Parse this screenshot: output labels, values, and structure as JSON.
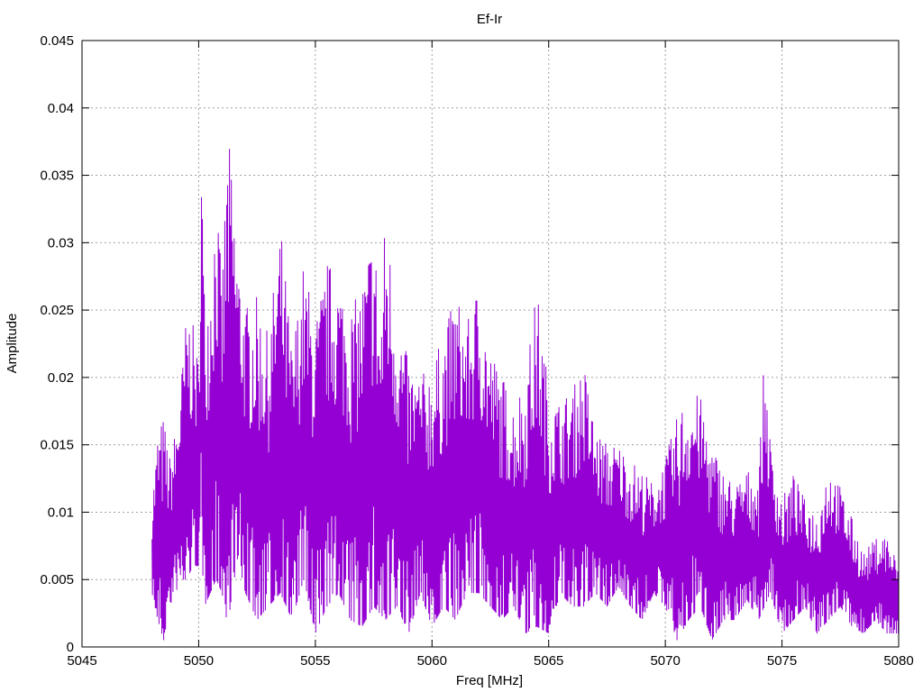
{
  "chart_data": {
    "type": "line",
    "title": "Ef-Ir",
    "xlabel": "Freq [MHz]",
    "ylabel": "Amplitude",
    "xlim": [
      5045,
      5080
    ],
    "ylim": [
      0,
      0.045
    ],
    "x_ticks": [
      5045,
      5050,
      5055,
      5060,
      5065,
      5070,
      5075,
      5080
    ],
    "x_tick_labels": [
      "5045",
      "5050",
      "5055",
      "5060",
      "5065",
      "5070",
      "5075",
      "5080"
    ],
    "y_ticks": [
      0,
      0.005,
      0.01,
      0.015,
      0.02,
      0.025,
      0.03,
      0.035,
      0.04,
      0.045
    ],
    "y_tick_labels": [
      "0",
      "0.005",
      "0.01",
      "0.015",
      "0.02",
      "0.025",
      "0.03",
      "0.035",
      "0.04",
      "0.045"
    ],
    "grid": true,
    "legend": "none",
    "series": [
      {
        "color": "#9400d3",
        "x": [
          5048,
          5048.25,
          5048.5,
          5048.75,
          5049,
          5049.25,
          5049.5,
          5049.75,
          5050,
          5050.1,
          5050.25,
          5050.5,
          5050.75,
          5051,
          5051.25,
          5051.5,
          5051.75,
          5052,
          5052.5,
          5053,
          5053.5,
          5054,
          5054.5,
          5055,
          5055.5,
          5056,
          5056.5,
          5057,
          5057.5,
          5057.8,
          5058,
          5058.5,
          5059,
          5059.5,
          5060,
          5060.5,
          5061,
          5061.5,
          5062,
          5062.5,
          5063,
          5063.5,
          5064,
          5064.5,
          5065,
          5065.5,
          5066,
          5066.5,
          5067,
          5067.5,
          5068,
          5068.5,
          5069,
          5069.5,
          5070,
          5070.5,
          5071,
          5071.5,
          5072,
          5072.5,
          5073,
          5073.5,
          5074,
          5074.25,
          5074.5,
          5075,
          5075.5,
          5076,
          5076.5,
          5077,
          5077.5,
          5078,
          5078.5,
          5079,
          5079.5,
          5080
        ],
        "y": [
          0.011,
          0.016,
          0.017,
          0.014,
          0.016,
          0.02,
          0.025,
          0.024,
          0.021,
          0.0405,
          0.026,
          0.028,
          0.034,
          0.027,
          0.0385,
          0.033,
          0.028,
          0.025,
          0.026,
          0.023,
          0.0312,
          0.022,
          0.0282,
          0.024,
          0.0283,
          0.0275,
          0.025,
          0.0268,
          0.0315,
          0.024,
          0.0322,
          0.025,
          0.021,
          0.02,
          0.021,
          0.023,
          0.0262,
          0.024,
          0.0268,
          0.022,
          0.02,
          0.018,
          0.02,
          0.0265,
          0.019,
          0.018,
          0.019,
          0.021,
          0.016,
          0.015,
          0.015,
          0.0138,
          0.013,
          0.012,
          0.014,
          0.017,
          0.019,
          0.0185,
          0.015,
          0.013,
          0.012,
          0.013,
          0.0128,
          0.022,
          0.015,
          0.011,
          0.0128,
          0.0108,
          0.01,
          0.0138,
          0.0118,
          0.0095,
          0.007,
          0.008,
          0.0085,
          0.006
        ]
      },
      {
        "color": "#9400d3",
        "x": [
          5048,
          5048.25,
          5048.5,
          5048.75,
          5049,
          5049.25,
          5049.5,
          5049.75,
          5050,
          5050.25,
          5050.5,
          5050.75,
          5051,
          5051.25,
          5051.5,
          5051.75,
          5052,
          5052.5,
          5053,
          5053.5,
          5054,
          5054.5,
          5055,
          5055.5,
          5056,
          5056.5,
          5057,
          5057.5,
          5058,
          5058.5,
          5059,
          5059.5,
          5060,
          5060.5,
          5061,
          5061.5,
          5062,
          5062.5,
          5063,
          5063.5,
          5064,
          5064.5,
          5065,
          5065.5,
          5066,
          5066.5,
          5067,
          5067.5,
          5068,
          5068.5,
          5069,
          5069.5,
          5070,
          5070.5,
          5071,
          5071.5,
          5072,
          5072.5,
          5073,
          5073.5,
          5074,
          5074.5,
          5075,
          5075.5,
          5076,
          5076.5,
          5077,
          5077.5,
          5078,
          5078.5,
          5079,
          5079.5,
          5080
        ],
        "y": [
          0.004,
          0.002,
          0.0005,
          0.003,
          0.004,
          0.005,
          0.005,
          0.006,
          0.006,
          0.003,
          0.004,
          0.005,
          0.004,
          0.0015,
          0.005,
          0.006,
          0.004,
          0.002,
          0.003,
          0.004,
          0.002,
          0.005,
          0.001,
          0.003,
          0.004,
          0.002,
          0.0015,
          0.003,
          0.002,
          0.003,
          0.001,
          0.004,
          0.0015,
          0.003,
          0.002,
          0.004,
          0.004,
          0.003,
          0.002,
          0.003,
          0.001,
          0.0015,
          0.001,
          0.004,
          0.003,
          0.003,
          0.004,
          0.003,
          0.0045,
          0.003,
          0.002,
          0.004,
          0.003,
          0.0005,
          0.002,
          0.003,
          0.0005,
          0.002,
          0.002,
          0.0035,
          0.002,
          0.004,
          0.001,
          0.002,
          0.003,
          0.001,
          0.002,
          0.003,
          0.0015,
          0.001,
          0.002,
          0.001,
          0.001
        ]
      }
    ]
  }
}
